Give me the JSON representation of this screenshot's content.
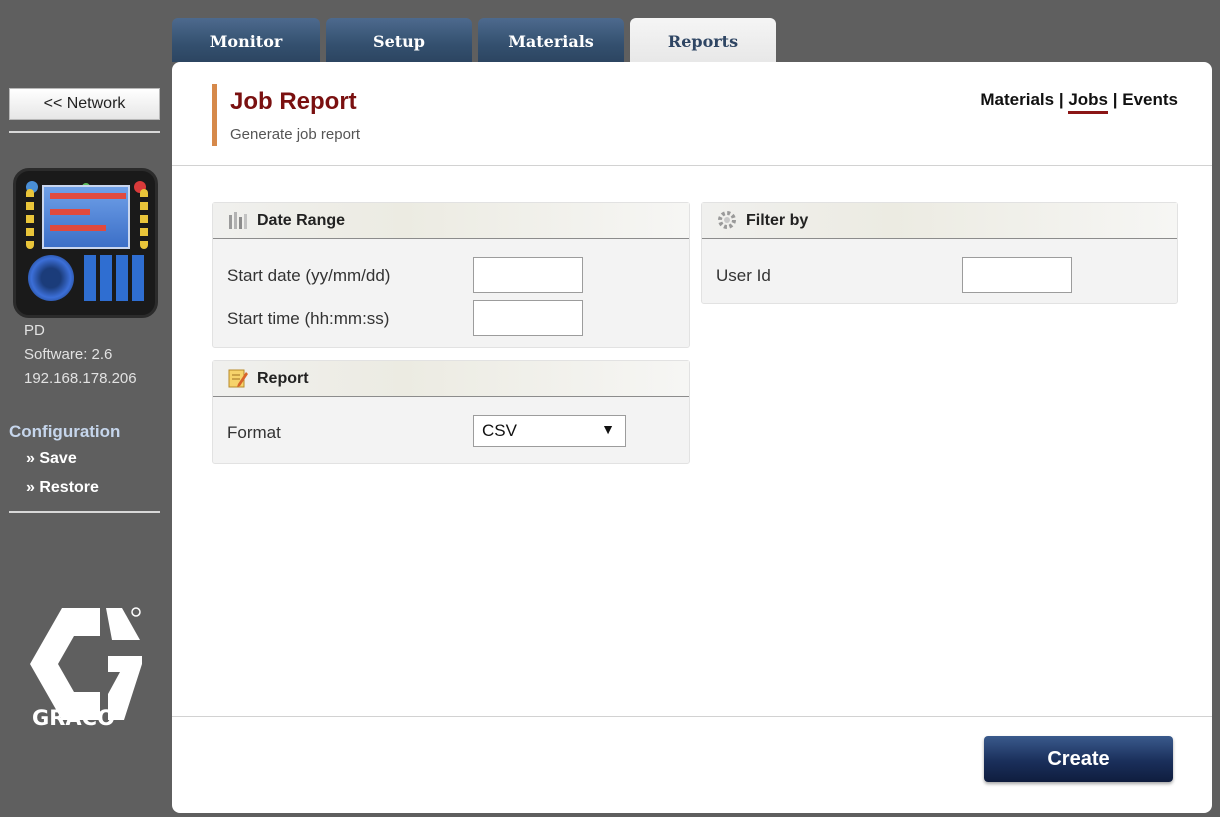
{
  "tabs": [
    {
      "label": "Monitor"
    },
    {
      "label": "Setup"
    },
    {
      "label": "Materials"
    },
    {
      "label": "Reports"
    }
  ],
  "sidebar": {
    "network_button": "<< Network",
    "device_name": "PD",
    "software": "Software: 2.6",
    "ip": "192.168.178.206",
    "config_title": "Configuration",
    "save_link": "» Save",
    "restore_link": "» Restore",
    "logo_text": "GRACO"
  },
  "header": {
    "title": "Job Report",
    "subtitle": "Generate job report",
    "links": {
      "materials": "Materials",
      "jobs": "Jobs",
      "events": "Events",
      "sep": "|"
    }
  },
  "date_range": {
    "title": "Date Range",
    "start_date_label": "Start date (yy/mm/dd)",
    "start_date_value": "",
    "start_time_label": "Start time (hh:mm:ss)",
    "start_time_value": ""
  },
  "report": {
    "title": "Report",
    "format_label": "Format",
    "format_value": "CSV"
  },
  "filter": {
    "title": "Filter by",
    "user_id_label": "User Id",
    "user_id_value": ""
  },
  "actions": {
    "create": "Create"
  },
  "colors": {
    "accent": "#7a1010",
    "tab_blue": "#34506f",
    "button_navy": "#1a2f5b"
  }
}
